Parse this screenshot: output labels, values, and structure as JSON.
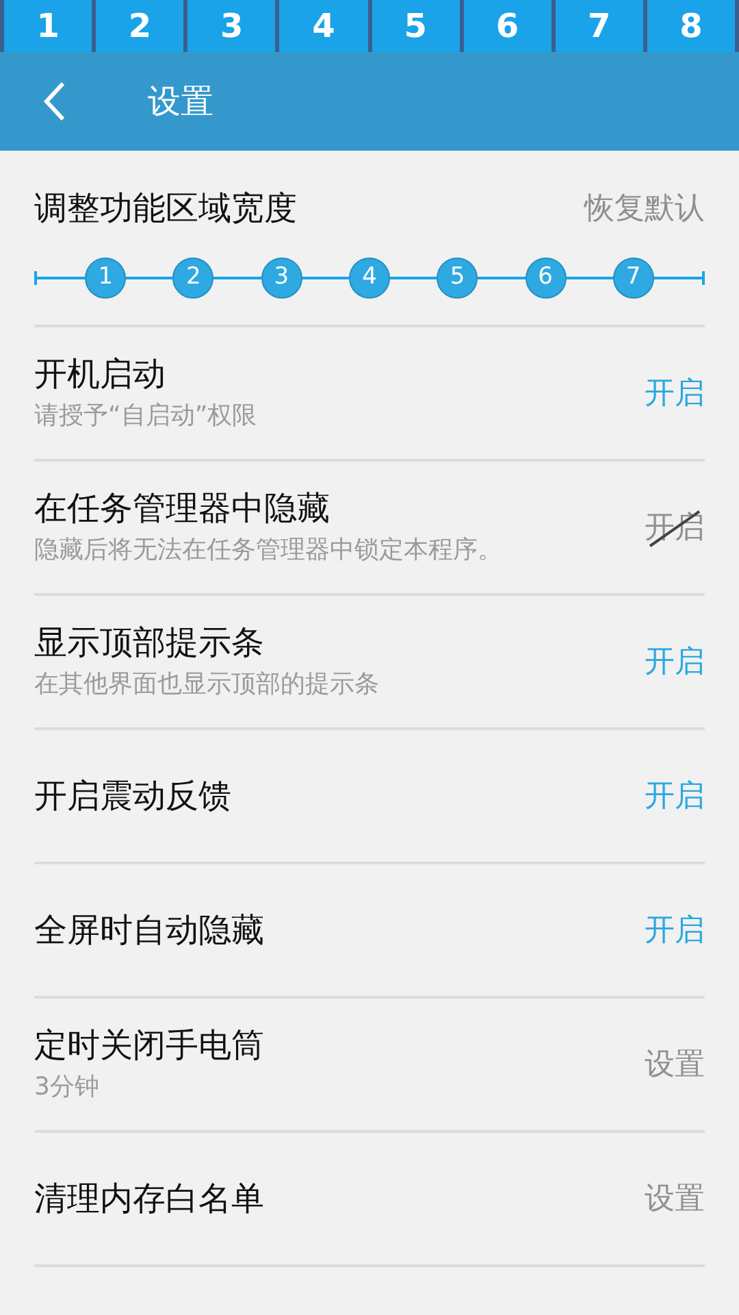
{
  "tabs": [
    {
      "label": "1",
      "selected": false
    },
    {
      "label": "2",
      "selected": false
    },
    {
      "label": "3",
      "selected": false
    },
    {
      "label": "4",
      "selected": false
    },
    {
      "label": "5",
      "selected": false
    },
    {
      "label": "6",
      "selected": false
    },
    {
      "label": "7",
      "selected": false
    },
    {
      "label": "8",
      "selected": false
    }
  ],
  "header": {
    "title": "设置"
  },
  "width_setting": {
    "title": "调整功能区域宽度",
    "reset": "恢复默认",
    "steps": [
      {
        "label": "1",
        "selected": false
      },
      {
        "label": "2",
        "selected": false
      },
      {
        "label": "3",
        "selected": false
      },
      {
        "label": "4",
        "selected": false
      },
      {
        "label": "5",
        "selected": false
      },
      {
        "label": "6",
        "selected": false
      },
      {
        "label": "7",
        "selected": false
      }
    ]
  },
  "settings": [
    {
      "kind": "toggle",
      "title": "开机启动",
      "subtitle": "请授予“自启动”权限",
      "action": "开启",
      "on": true
    },
    {
      "kind": "toggle",
      "title": "在任务管理器中隐藏",
      "subtitle": "隐藏后将无法在任务管理器中锁定本程序。",
      "action": "开启",
      "on": false
    },
    {
      "kind": "toggle",
      "title": "显示顶部提示条",
      "subtitle": "在其他界面也显示顶部的提示条",
      "action": "开启",
      "on": true
    },
    {
      "kind": "toggle",
      "title": "开启震动反馈",
      "action": "开启",
      "on": true
    },
    {
      "kind": "toggle",
      "title": "全屏时自动隐藏",
      "action": "开启",
      "on": true
    },
    {
      "kind": "link",
      "title": "定时关闭手电筒",
      "subtitle": "3分钟",
      "action": "设置"
    },
    {
      "kind": "link",
      "title": "清理内存白名单",
      "action": "设置"
    }
  ]
}
